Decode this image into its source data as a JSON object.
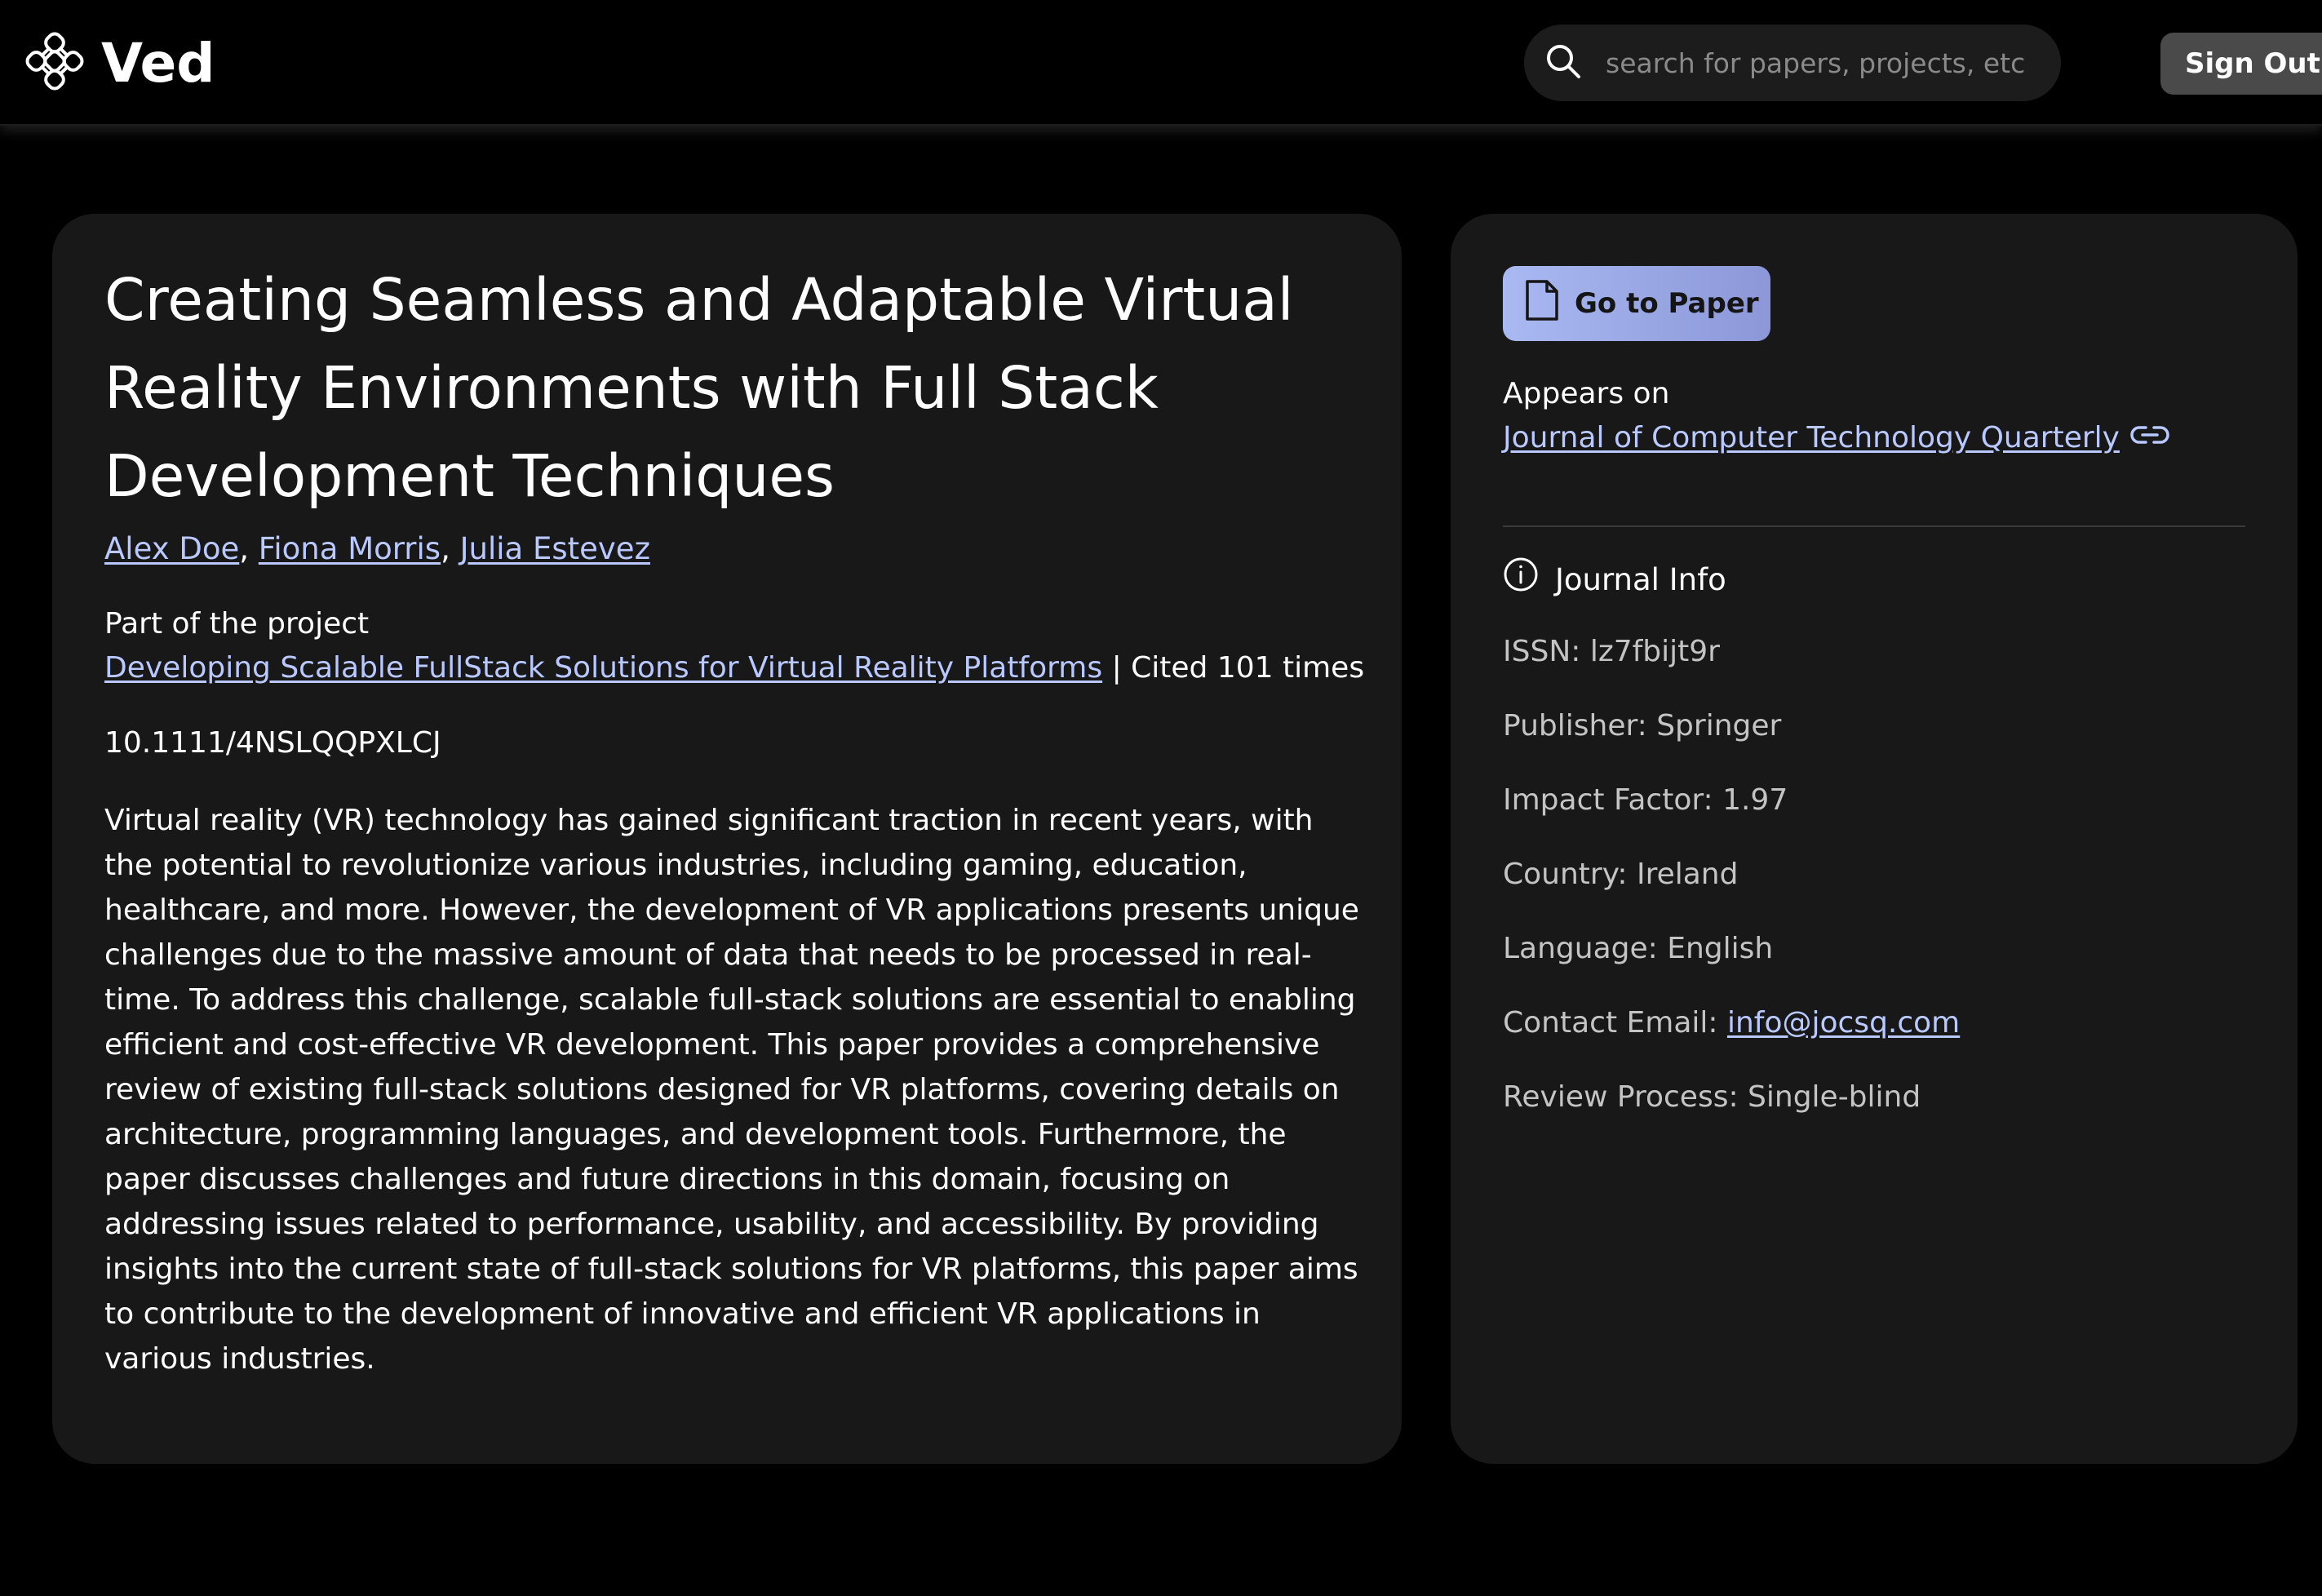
{
  "app": {
    "name": "Ved"
  },
  "search": {
    "placeholder": "search for papers, projects, etc"
  },
  "header": {
    "signout_label": "Sign Out"
  },
  "paper": {
    "title": "Creating Seamless and Adaptable Virtual Reality Environments with Full Stack Development Techniques",
    "authors": [
      "Alex Doe",
      "Fiona Morris",
      "Julia Estevez"
    ],
    "author_separator": ", ",
    "project_label": "Part of the project",
    "project_name": "Developing Scalable FullStack Solutions for Virtual Reality Platforms",
    "citation_text": " | Cited 101 times",
    "doi": "10.1111/4NSLQQPXLCJ",
    "abstract": "Virtual reality (VR) technology has gained significant traction in recent years, with the potential to revolutionize various industries, including gaming, education, healthcare, and more. However, the development of VR applications presents unique challenges due to the massive amount of data that needs to be processed in real-time. To address this challenge, scalable full-stack solutions are essential to enabling efficient and cost-effective VR development. This paper provides a comprehensive review of existing full-stack solutions designed for VR platforms, covering details on architecture, programming languages, and development tools. Furthermore, the paper discusses challenges and future directions in this domain, focusing on addressing issues related to performance, usability, and accessibility. By providing insights into the current state of full-stack solutions for VR platforms, this paper aims to contribute to the development of innovative and efficient VR applications in various industries."
  },
  "side": {
    "goto_label": "Go to Paper",
    "appears_label": "Appears on",
    "journal_name": "Journal of Computer Technology Quarterly",
    "info_heading": "Journal Info",
    "issn": "ISSN: lz7fbijt9r",
    "publisher": "Publisher: Springer",
    "impact": "Impact Factor: 1.97",
    "country": "Country: Ireland",
    "language": "Language: English",
    "email_label": "Contact Email: ",
    "email": "info@jocsq.com",
    "review": "Review Process: Single-blind"
  },
  "icons": {
    "logo": "knot-logo-icon",
    "search": "search-icon",
    "document": "document-icon",
    "link": "link-icon",
    "info": "info-icon"
  },
  "colors": {
    "background": "#000000",
    "card": "#181818",
    "link": "#b9c8ff",
    "button_gradient_start": "#a9b9f2",
    "button_gradient_end": "#8c97d8",
    "muted_text": "#c4c4c4"
  }
}
